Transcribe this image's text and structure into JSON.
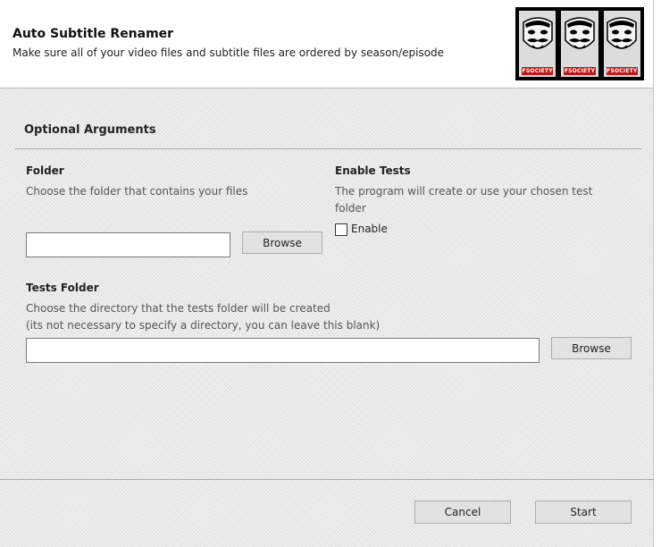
{
  "header": {
    "title": "Auto Subtitle Renamer",
    "subtitle": "Make sure all of your video files and subtitle files are ordered by season/episode",
    "logo_text": [
      "FSOCIETY",
      "FSOCIETY",
      "FSOCIETY"
    ]
  },
  "optional_arguments": {
    "title": "Optional Arguments",
    "folder": {
      "label": "Folder",
      "description": "Choose the folder that contains your files",
      "value": "",
      "browse_label": "Browse"
    },
    "enable_tests": {
      "label": "Enable Tests",
      "description_line1": "The program will create or use your chosen test",
      "description_line2": "folder",
      "checkbox_label": "Enable",
      "checked": false
    },
    "tests_folder": {
      "label": "Tests Folder",
      "description_line1": "Choose the directory that the tests folder will be created",
      "description_line2": "(its not necessary to specify a directory, you can leave this blank)",
      "value": "",
      "browse_label": "Browse"
    }
  },
  "footer": {
    "cancel_label": "Cancel",
    "start_label": "Start"
  },
  "colors": {
    "header_bg": "#ffffff",
    "body_bg": "#f0f0f0",
    "button_bg": "#e2e2e2",
    "logo_tag": "#c01818"
  }
}
